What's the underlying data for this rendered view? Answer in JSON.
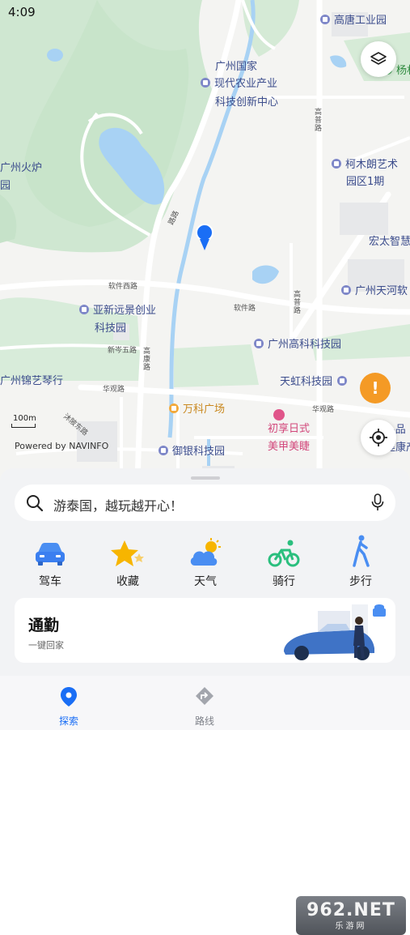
{
  "status": {
    "time": "4:09"
  },
  "map": {
    "labels": {
      "gaotang": "高唐工业园",
      "national_line1": "广州国家",
      "national_line2": "现代农业产业",
      "national_line3": "科技创新中心",
      "yang": "杨村",
      "gaopu_road": "高普路",
      "kemulang_line1": "柯木朗艺术",
      "kemulang_line2": "园区1期",
      "huolu_line1": "广州火炉",
      "huolu_line2": "园",
      "hongtai": "宏太智慧",
      "tianhe": "广州天河软",
      "ruanjian_road": "软件西路",
      "yaxin_line1": "亚新远景创业",
      "yaxin_line2": "科技园",
      "ruanjian_road2": "软件路",
      "gaopu_road2": "高普路",
      "xincen": "新岑五路",
      "gaokang": "高康路",
      "gaoke": "广州高科科技园",
      "jinyi": "广州锦艺琴行",
      "tianhong": "天虹科技园",
      "huaguan": "华观路",
      "huaguan2": "华观路",
      "wanke": "万科广场",
      "chuxiang_line1": "初享日式",
      "chuxiang_line2": "美甲美睫",
      "muyu": "沐陂东路",
      "yuyin": "御银科技园",
      "edge1": "东",
      "edge2": "-品",
      "edge3": "健康产",
      "road_top": "路路"
    },
    "scale": "100m",
    "powered_by": "Powered by NAVINFO"
  },
  "search": {
    "placeholder": "游泰国，越玩越开心！"
  },
  "shortcuts": [
    {
      "label": "驾车",
      "icon": "car-icon"
    },
    {
      "label": "收藏",
      "icon": "star-icon"
    },
    {
      "label": "天气",
      "icon": "weather-icon"
    },
    {
      "label": "骑行",
      "icon": "bike-icon"
    },
    {
      "label": "步行",
      "icon": "walk-icon"
    }
  ],
  "commute": {
    "title": "通勤",
    "subtitle": "一键回家"
  },
  "tabs": [
    {
      "label": "探索",
      "active": true
    },
    {
      "label": "路线",
      "active": false
    }
  ],
  "watermark": {
    "brand": "962.NET",
    "sub": "乐游网"
  },
  "colors": {
    "accent": "#1a6ef5",
    "map_green": "#cde6cf",
    "water": "#a8d2f4"
  }
}
